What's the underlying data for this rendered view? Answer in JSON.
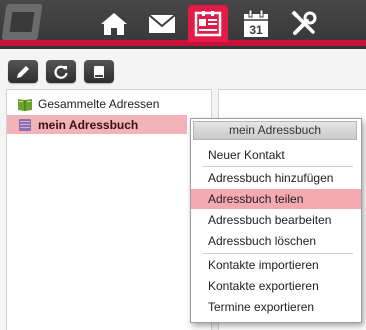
{
  "nav": {
    "items": [
      {
        "name": "home-icon",
        "label": "Home"
      },
      {
        "name": "mail-icon",
        "label": "E-Mail"
      },
      {
        "name": "addressbook-icon",
        "label": "Adressbuch"
      },
      {
        "name": "calendar-icon",
        "label": "Kalender",
        "day": "31"
      },
      {
        "name": "settings-icon",
        "label": "Einstellungen"
      }
    ],
    "active": "addressbook-icon",
    "accent": "#e21b47"
  },
  "toolbar": {
    "buttons": [
      {
        "name": "edit-icon"
      },
      {
        "name": "refresh-icon"
      },
      {
        "name": "book-icon"
      }
    ]
  },
  "addressbooks": {
    "items": [
      {
        "label": "Gesammelte Adressen",
        "icon": "collected-book-icon"
      },
      {
        "label": "mein Adressbuch",
        "icon": "addressbook-book-icon",
        "selected": true
      }
    ]
  },
  "context_menu": {
    "title": "mein Adressbuch",
    "items": [
      {
        "label": "Neuer Kontakt"
      },
      {
        "label": "Adressbuch hinzufügen"
      },
      {
        "label": "Adressbuch teilen",
        "highlighted": true
      },
      {
        "label": "Adressbuch bearbeiten"
      },
      {
        "label": "Adressbuch löschen"
      },
      {
        "label": "Kontakte importieren"
      },
      {
        "label": "Kontakte exportieren"
      },
      {
        "label": "Termine exportieren"
      }
    ],
    "highlight_color": "#f5aab1"
  },
  "colors": {
    "topbar": "#3d3d3d",
    "accent_red": "#c8103b",
    "selection": "#f1b3b8"
  }
}
